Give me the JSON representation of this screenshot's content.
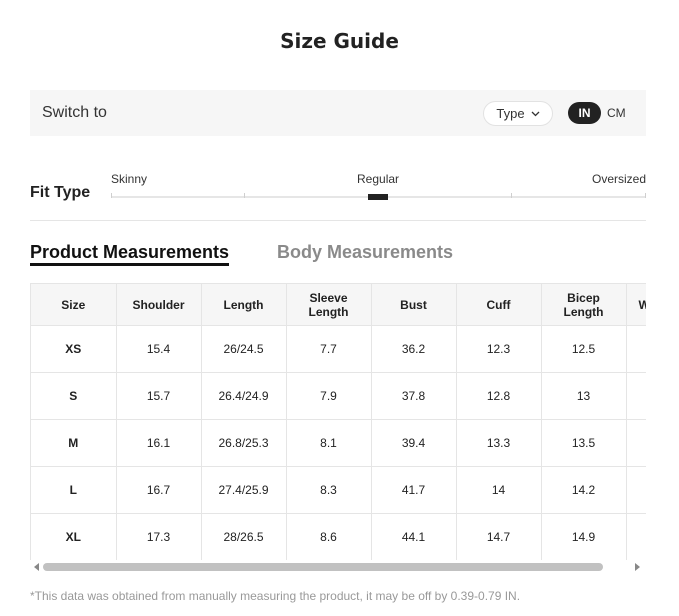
{
  "title": "Size Guide",
  "switch_bar": {
    "label": "Switch to",
    "type_label": "Type",
    "unit_in": "IN",
    "unit_cm": "CM",
    "selected_unit": "IN"
  },
  "fit": {
    "label": "Fit Type",
    "options": [
      "Skinny",
      "Regular",
      "Oversized"
    ],
    "selected": "Regular"
  },
  "tabs": [
    {
      "label": "Product Measurements",
      "active": true
    },
    {
      "label": "Body Measurements",
      "active": false
    }
  ],
  "table": {
    "headers": [
      "Size",
      "Shoulder",
      "Length",
      "Sleeve Length",
      "Bust",
      "Cuff",
      "Bicep Length",
      "W"
    ],
    "rows": [
      [
        "XS",
        "15.4",
        "26/24.5",
        "7.7",
        "36.2",
        "12.3",
        "12.5",
        ""
      ],
      [
        "S",
        "15.7",
        "26.4/24.9",
        "7.9",
        "37.8",
        "12.8",
        "13",
        ""
      ],
      [
        "M",
        "16.1",
        "26.8/25.3",
        "8.1",
        "39.4",
        "13.3",
        "13.5",
        ""
      ],
      [
        "L",
        "16.7",
        "27.4/25.9",
        "8.3",
        "41.7",
        "14",
        "14.2",
        ""
      ],
      [
        "XL",
        "17.3",
        "28/26.5",
        "8.6",
        "44.1",
        "14.7",
        "14.9",
        ""
      ]
    ]
  },
  "footnote": "*This data was obtained from manually measuring the product, it may be off by 0.39-0.79 IN.",
  "icons": {
    "type_dropdown": "chevron-down-icon",
    "scroll_left": "scroll-left-arrow-icon",
    "scroll_right": "scroll-right-arrow-icon"
  },
  "colors": {
    "accent": "#222222",
    "header_bg": "#f6f6f6",
    "border": "#e5e5e5",
    "muted_text": "#8a8a8a"
  }
}
